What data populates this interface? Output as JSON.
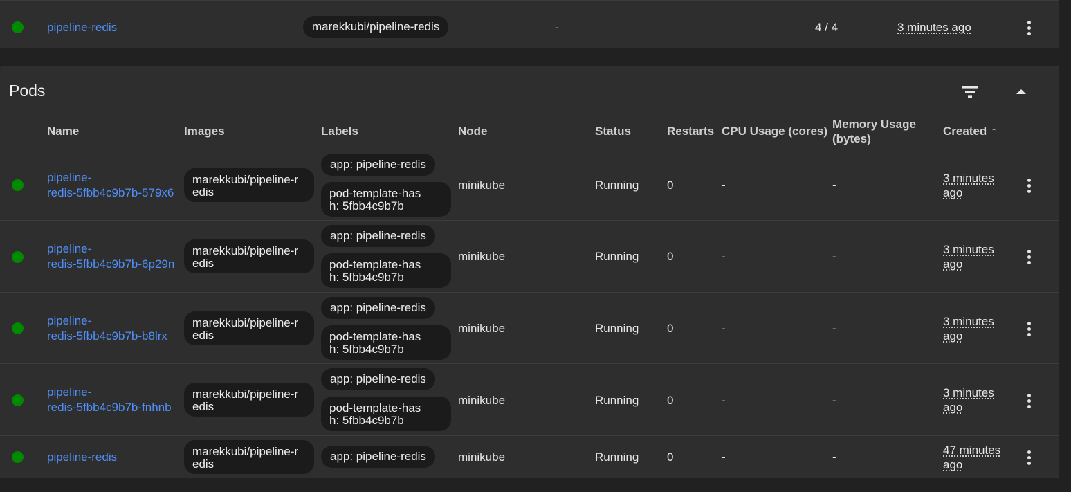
{
  "deployment_row": {
    "name": "pipeline-redis",
    "image": "marekkubi/pipeline-redis",
    "labels": "-",
    "pods": "4 / 4",
    "created": "3 minutes ago"
  },
  "pods": {
    "title": "Pods",
    "filter_icon": "filter-icon",
    "collapse_icon": "chevron-up-icon",
    "columns": {
      "name": "Name",
      "images": "Images",
      "labels": "Labels",
      "node": "Node",
      "status": "Status",
      "restarts": "Restarts",
      "cpu": "CPU Usage (cores)",
      "memory_1": "Memory Usage",
      "memory_2": "(bytes)",
      "created": "Created",
      "sort_arrow": "↑"
    },
    "rows": [
      {
        "name_1": "pipeline-",
        "name_2": "redis-5fbb4c9b7b-579x6",
        "image_1": "marekkubi/pipeline-r",
        "image_2": "edis",
        "label_app": "app: pipeline-redis",
        "label_hash_1": "pod-template-has",
        "label_hash_2": "h: 5fbb4c9b7b",
        "node": "minikube",
        "status": "Running",
        "restarts": "0",
        "cpu": "-",
        "memory": "-",
        "created_1": "3 minutes",
        "created_2": "ago"
      },
      {
        "name_1": "pipeline-",
        "name_2": "redis-5fbb4c9b7b-6p29n",
        "image_1": "marekkubi/pipeline-r",
        "image_2": "edis",
        "label_app": "app: pipeline-redis",
        "label_hash_1": "pod-template-has",
        "label_hash_2": "h: 5fbb4c9b7b",
        "node": "minikube",
        "status": "Running",
        "restarts": "0",
        "cpu": "-",
        "memory": "-",
        "created_1": "3 minutes",
        "created_2": "ago"
      },
      {
        "name_1": "pipeline-",
        "name_2": "redis-5fbb4c9b7b-b8lrx",
        "image_1": "marekkubi/pipeline-r",
        "image_2": "edis",
        "label_app": "app: pipeline-redis",
        "label_hash_1": "pod-template-has",
        "label_hash_2": "h: 5fbb4c9b7b",
        "node": "minikube",
        "status": "Running",
        "restarts": "0",
        "cpu": "-",
        "memory": "-",
        "created_1": "3 minutes",
        "created_2": "ago"
      },
      {
        "name_1": "pipeline-",
        "name_2": "redis-5fbb4c9b7b-fnhnb",
        "image_1": "marekkubi/pipeline-r",
        "image_2": "edis",
        "label_app": "app: pipeline-redis",
        "label_hash_1": "pod-template-has",
        "label_hash_2": "h: 5fbb4c9b7b",
        "node": "minikube",
        "status": "Running",
        "restarts": "0",
        "cpu": "-",
        "memory": "-",
        "created_1": "3 minutes",
        "created_2": "ago"
      },
      {
        "name": "pipeline-redis",
        "image_1": "marekkubi/pipeline-r",
        "image_2": "edis",
        "label_app": "app: pipeline-redis",
        "node": "minikube",
        "status": "Running",
        "restarts": "0",
        "cpu": "-",
        "memory": "-",
        "created_1": "47 minutes",
        "created_2": "ago"
      }
    ]
  },
  "colors": {
    "background": "#212121",
    "card": "#2e2e2e",
    "link": "#4f8ff7",
    "status_ok": "#008a00",
    "chip": "#1b1b1b"
  }
}
